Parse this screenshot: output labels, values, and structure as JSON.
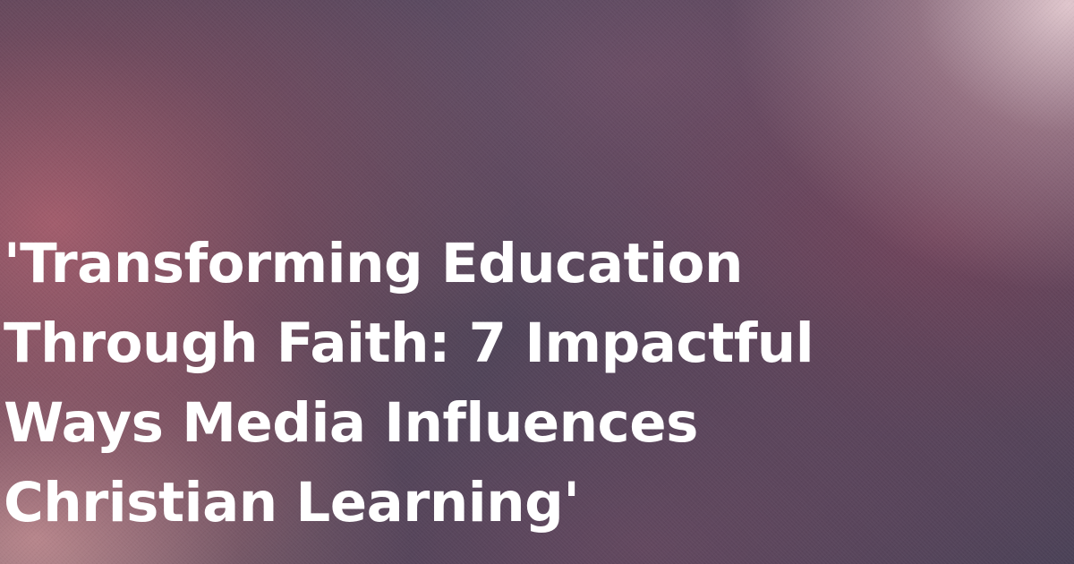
{
  "header": {
    "title": "'Transforming Education\nThrough Faith: 7 Impactful\nWays Media Influences\nChristian Learning'"
  },
  "colors": {
    "text": "#ffffff",
    "background_base": "#4c4557",
    "accent_rose": "#ac606f",
    "accent_pink_light": "#e8ced4"
  }
}
